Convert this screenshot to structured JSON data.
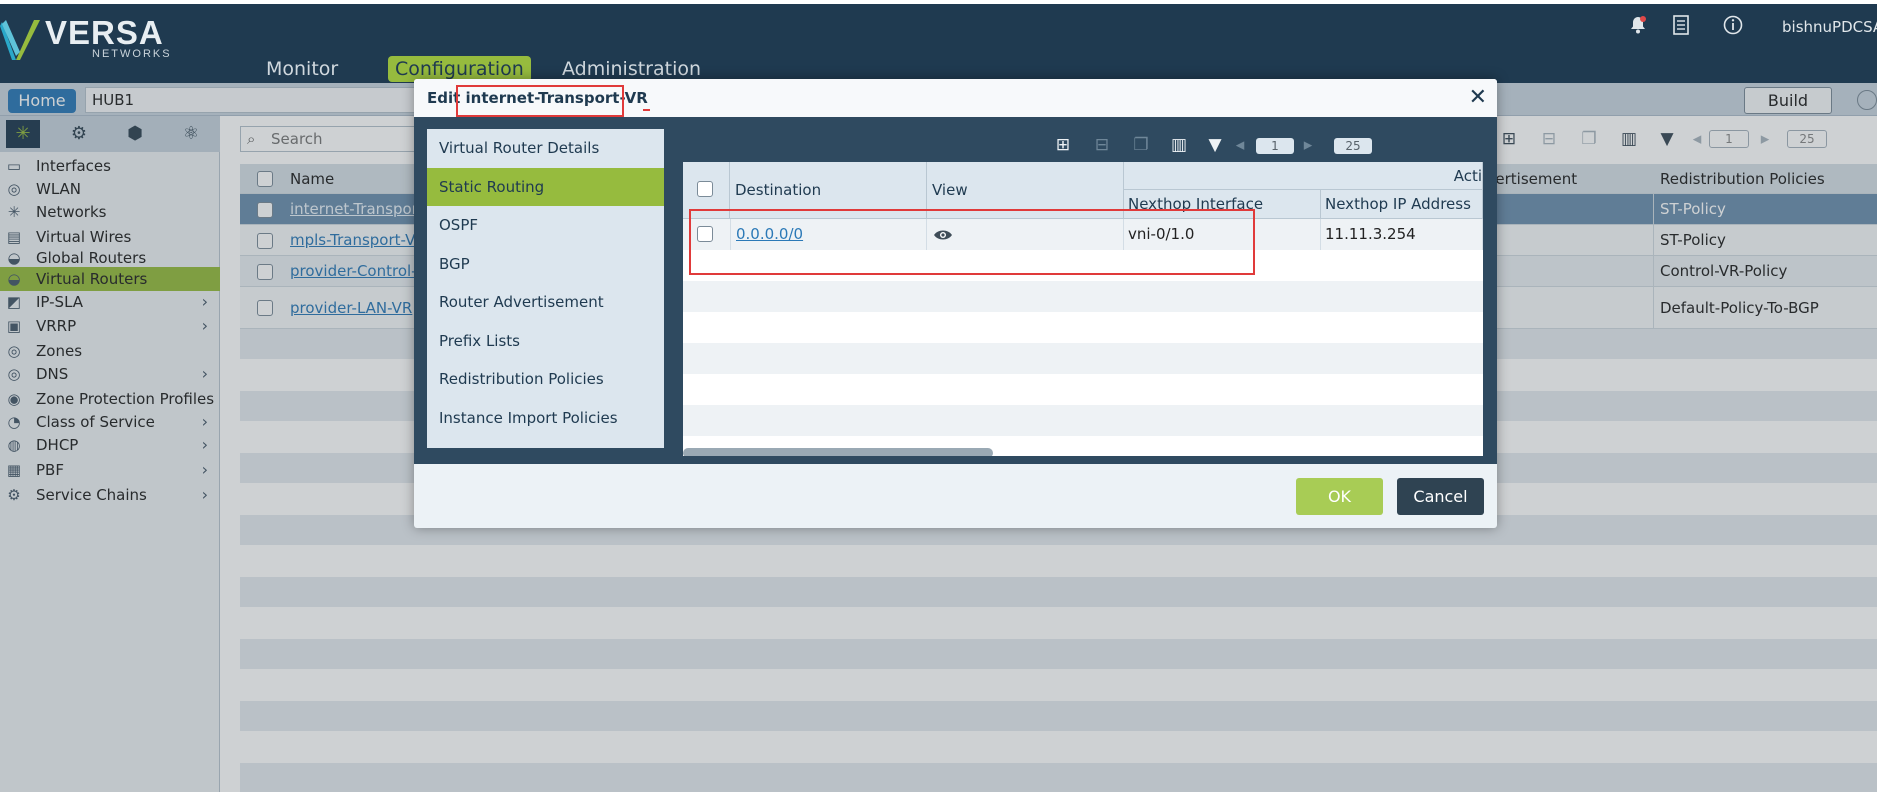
{
  "header": {
    "logo_text": "VERSA",
    "logo_sub": "NETWORKS",
    "nav": [
      "Monitor",
      "Configuration",
      "Administration"
    ],
    "active_nav": "Configuration",
    "username": "bishnuPDCSA",
    "icons": [
      "bell-icon",
      "report-icon",
      "info-icon"
    ]
  },
  "breadcrumb": {
    "home_label": "Home",
    "path": "HUB1",
    "build_label": "Build"
  },
  "sidebar": {
    "tab_icons": [
      "network-icon",
      "gear-icon",
      "box-icon",
      "globe-gear-icon"
    ],
    "items": [
      {
        "label": "Interfaces",
        "icon": "interfaces-icon",
        "expandable": false
      },
      {
        "label": "WLAN",
        "icon": "wifi-icon",
        "expandable": false
      },
      {
        "label": "Networks",
        "icon": "network-icon",
        "expandable": false
      },
      {
        "label": "Virtual Wires",
        "icon": "wire-icon",
        "expandable": false
      },
      {
        "label": "Global Routers",
        "icon": "router-icon",
        "expandable": false
      },
      {
        "label": "Virtual Routers",
        "icon": "router-icon",
        "expandable": false,
        "active": true
      },
      {
        "label": "IP-SLA",
        "icon": "chart-icon",
        "expandable": true
      },
      {
        "label": "VRRP",
        "icon": "vrrp-icon",
        "expandable": true
      },
      {
        "label": "Zones",
        "icon": "wifi-icon",
        "expandable": false
      },
      {
        "label": "DNS",
        "icon": "wifi-icon",
        "expandable": true
      },
      {
        "label": "Zone Protection Profiles",
        "icon": "shield-icon",
        "expandable": false
      },
      {
        "label": "Class of Service",
        "icon": "cos-icon",
        "expandable": true
      },
      {
        "label": "DHCP",
        "icon": "dhcp-icon",
        "expandable": true
      },
      {
        "label": "PBF",
        "icon": "pbf-icon",
        "expandable": true
      },
      {
        "label": "Service Chains",
        "icon": "gear-icon",
        "expandable": true
      }
    ]
  },
  "main": {
    "search_placeholder": "Search",
    "pager_page": "1",
    "pager_size": "25",
    "columns": [
      "Name",
      "dvertisement",
      "Redistribution Policies"
    ],
    "rows": [
      {
        "name": "internet-Transpor",
        "policy": "ST-Policy",
        "selected": true
      },
      {
        "name": "mpls-Transport-VR",
        "policy": "ST-Policy",
        "selected": false
      },
      {
        "name": "provider-Control-V",
        "policy": "Control-VR-Policy",
        "selected": false
      },
      {
        "name": "provider-LAN-VR",
        "policy": "Default-Policy-To-BGP",
        "selected": false
      }
    ]
  },
  "modal": {
    "title_prefix": "Edit",
    "title_name": "internet-Transport-VR",
    "nav": [
      "Virtual Router Details",
      "Static Routing",
      "OSPF",
      "BGP",
      "Router Advertisement",
      "Prefix Lists",
      "Redistribution Policies",
      "Instance Import Policies"
    ],
    "active_nav": "Static Routing",
    "pager_page": "1",
    "pager_size": "25",
    "table": {
      "group_header": "Acti",
      "columns": {
        "destination": "Destination",
        "view": "View",
        "nexthop_interface": "Nexthop Interface",
        "nexthop_ip": "Nexthop IP Address"
      },
      "rows": [
        {
          "destination": "0.0.0.0/0",
          "nexthop_interface": "vni-0/1.0",
          "nexthop_ip": "11.11.3.254"
        }
      ]
    },
    "ok_label": "OK",
    "cancel_label": "Cancel"
  },
  "colors": {
    "header_bg": "#1f3a50",
    "accent_green": "#96bb3e",
    "link_blue": "#2b79b7",
    "highlight_red": "#e03a3a"
  }
}
